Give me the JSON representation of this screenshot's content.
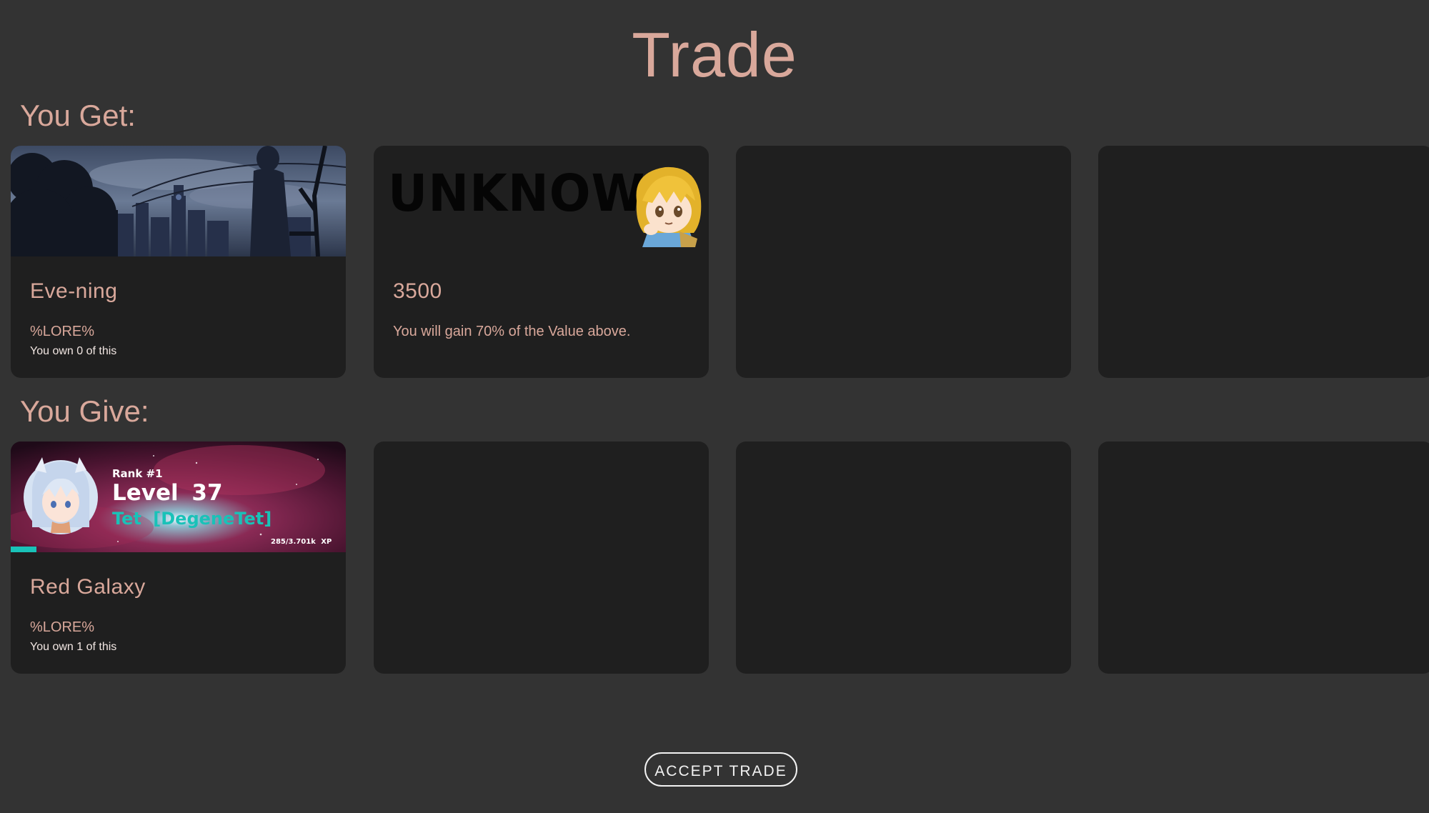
{
  "page": {
    "title": "Trade"
  },
  "sections": {
    "get_label": "You Get:",
    "give_label": "You Give:"
  },
  "get_cards": [
    {
      "title": "Eve-ning",
      "lore": "%LORE%",
      "ownership": "You own 0 of this",
      "image": "evening-city-banner"
    },
    {
      "title": "3500",
      "banner_text": "UNKNOWN",
      "description": "You will gain 70% of the Value above.",
      "image": "unknown-currency-banner"
    }
  ],
  "give_cards": [
    {
      "title": "Red Galaxy",
      "lore": "%LORE%",
      "ownership": "You own 1 of this",
      "image": "red-galaxy-banner",
      "banner": {
        "rank": "Rank #1",
        "level": "Level 37",
        "name": "Tet [DegeneTet]",
        "xp": "285/3.701k XP"
      }
    }
  ],
  "actions": {
    "accept_label": "ACCEPT TRADE"
  },
  "colors": {
    "background": "#333333",
    "card": "#1f1f1f",
    "accent_text": "#d9a89b",
    "xp_bar": "#19c2b8"
  }
}
